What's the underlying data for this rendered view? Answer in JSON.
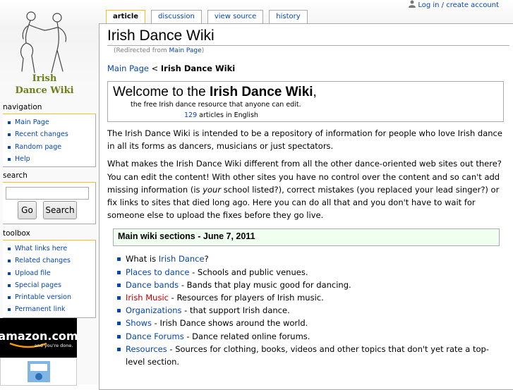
{
  "personal": {
    "login_label": "Log in / create account"
  },
  "logo": {
    "line1": "Irish",
    "line2": "Dance Wiki"
  },
  "tabs": [
    {
      "label": "article",
      "selected": true
    },
    {
      "label": "discussion",
      "selected": false
    },
    {
      "label": "view source",
      "selected": false
    },
    {
      "label": "history",
      "selected": false
    }
  ],
  "page": {
    "title": "Irish Dance Wiki",
    "redirect_prefix": "(Redirected from ",
    "redirect_link": "Main Page",
    "redirect_suffix": ")"
  },
  "breadcrumb": {
    "link": "Main Page",
    "separator": " < ",
    "current": "Irish Dance Wiki"
  },
  "welcome": {
    "prefix": "Welcome to the ",
    "name": "Irish Dance Wiki",
    "suffix": ",",
    "subtitle": "the free Irish dance resource that anyone can edit.",
    "article_count": "129",
    "count_suffix": " articles in English"
  },
  "intro": "The Irish Dance Wiki is intended to be a repository of information for people who love Irish dance in all its forms as dancers, musicians or just spectators.",
  "intro2": {
    "part1": "What makes the Irish Dance Wiki different from all the other dance-oriented web sites out there? You can edit the content! With other sites you have no control over the content and so can't add missing information (is ",
    "emph": "your",
    "part2": " school listed?), correct mistakes (you replaced your lead singer?) or fix links to sites that died long ago. Here you can do all that and you don't have to wait for someone else to upload the fixes before they go live."
  },
  "sections_header": "Main wiki sections - June 7, 2011",
  "sections": [
    {
      "pre": "What is ",
      "link": "Irish Dance",
      "post": "?",
      "red": false
    },
    {
      "pre": "",
      "link": "Places to dance",
      "post": " - Schools and public venues.",
      "red": false
    },
    {
      "pre": "",
      "link": "Dance bands",
      "post": " - Bands that play music good for dancing.",
      "red": false
    },
    {
      "pre": "",
      "link": "Irish Music",
      "post": " - Resources for players of Irish music.",
      "red": true
    },
    {
      "pre": "",
      "link": "Organizations",
      "post": " - that support Irish dance.",
      "red": false
    },
    {
      "pre": "",
      "link": "Shows",
      "post": " - Irish Dance shows around the world.",
      "red": false
    },
    {
      "pre": "",
      "link": "Dance Forums",
      "post": " - Dance related online forums.",
      "red": false
    },
    {
      "pre": "",
      "link": "Resources",
      "post": " - Sources for clothing, books, videos and other topics that don't yet rate a top-level section.",
      "red": false
    }
  ],
  "navigation": {
    "title": "navigation",
    "items": [
      "Main Page",
      "Recent changes",
      "Random page",
      "Help"
    ]
  },
  "search": {
    "title": "search",
    "go_label": "Go",
    "search_label": "Search"
  },
  "toolbox": {
    "title": "toolbox",
    "items": [
      "What links here",
      "Related changes",
      "Upload file",
      "Special pages",
      "Printable version",
      "Permanent link"
    ]
  },
  "ads": {
    "amazon_text": "amazon.com",
    "amazon_tagline": "and you're done."
  },
  "colors": {
    "link": "#0645ad",
    "redlink": "#ba0000",
    "tab_selected": "#fabd23",
    "section_bg": "#f0fff0"
  }
}
